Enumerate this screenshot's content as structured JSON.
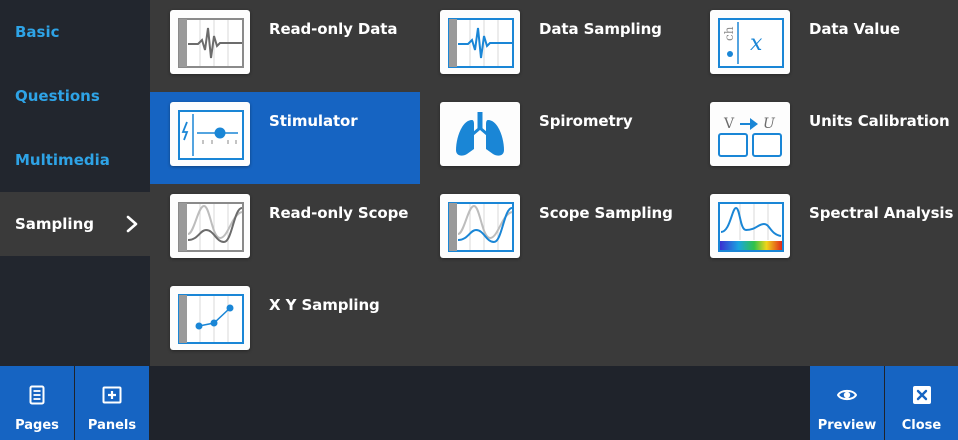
{
  "sidebar": {
    "items": [
      {
        "label": "Basic"
      },
      {
        "label": "Questions"
      },
      {
        "label": "Multimedia"
      },
      {
        "label": "Sampling",
        "icon": "chevron-right-icon"
      }
    ]
  },
  "tiles": [
    {
      "label": "Read-only Data",
      "icon": "read-only-data-icon"
    },
    {
      "label": "Data Sampling",
      "icon": "data-sampling-icon"
    },
    {
      "label": "Data Value",
      "icon": "data-value-icon"
    },
    {
      "label": "Stimulator",
      "icon": "stimulator-icon"
    },
    {
      "label": "Spirometry",
      "icon": "lungs-icon"
    },
    {
      "label": "Units Calibration",
      "icon": "units-calibration-icon",
      "glyph_left": "V",
      "glyph_right": "U"
    },
    {
      "label": "Read-only Scope",
      "icon": "read-only-scope-icon"
    },
    {
      "label": "Scope Sampling",
      "icon": "scope-sampling-icon"
    },
    {
      "label": "Spectral Analysis",
      "icon": "spectral-analysis-icon"
    },
    {
      "label": "X Y Sampling",
      "icon": "xy-sampling-icon"
    }
  ],
  "footer": {
    "pages_label": "Pages",
    "panels_label": "Panels",
    "preview_label": "Preview",
    "close_label": "Close"
  },
  "colors": {
    "accent": "#1664c2",
    "link": "#2ea3e6",
    "panel": "#3a3a3a",
    "dark": "#1f232b"
  }
}
